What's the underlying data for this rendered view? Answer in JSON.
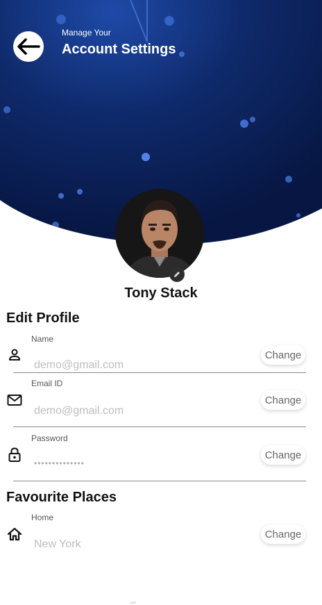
{
  "header": {
    "subtitle": "Manage Your",
    "title": "Account Settings"
  },
  "profile": {
    "name": "Tony Stack"
  },
  "edit_profile": {
    "title": "Edit Profile",
    "fields": [
      {
        "label": "Name",
        "value": "demo@gmail.com",
        "button": "Change",
        "icon": "person-icon"
      },
      {
        "label": "Email ID",
        "value": "demo@gmail.com",
        "button": "Change",
        "icon": "mail-icon"
      },
      {
        "label": "Password",
        "value": "••••••••••••••",
        "button": "Change",
        "icon": "lock-icon"
      }
    ]
  },
  "favourite_places": {
    "title": "Favourite Places",
    "fields": [
      {
        "label": "Home",
        "value": "New York",
        "button": "Change",
        "icon": "home-icon"
      }
    ]
  },
  "colors": {
    "hero_bg": "#0b1e4e",
    "hero_glow": "#1e4aa8",
    "accent": "#ffffff"
  }
}
